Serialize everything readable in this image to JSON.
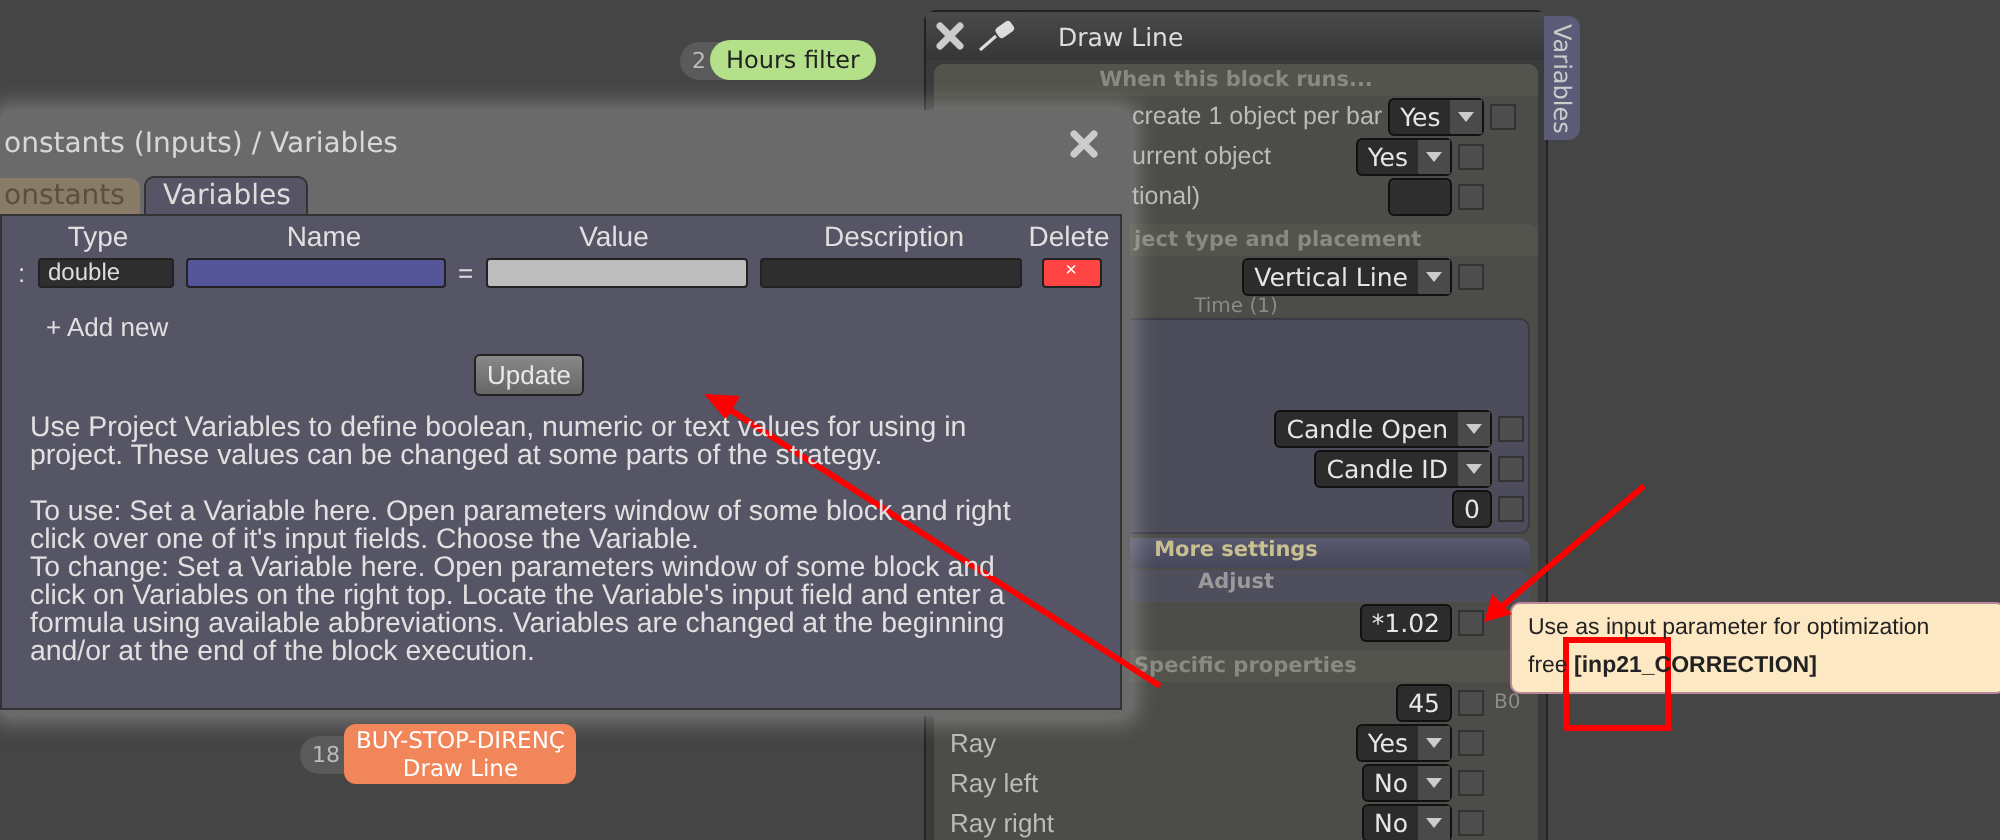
{
  "canvas_nodes": [
    {
      "number": "2",
      "label": "Hours filter",
      "color": "#b5e08a"
    },
    {
      "number": "18",
      "label": "BUY-STOP-DIRENÇ",
      "sublabel": "Draw Line",
      "color": "#f0865a"
    }
  ],
  "block_panel": {
    "title": "Draw Line",
    "side_tab": "Variables",
    "rows": [
      {
        "kind": "header",
        "text": "When this block runs..."
      },
      {
        "kind": "dropdown",
        "label": "create 1 object per bar",
        "value": "Yes",
        "checked": false
      },
      {
        "kind": "dropdown",
        "label": "urrent object",
        "value": "Yes",
        "checked": false
      },
      {
        "kind": "field",
        "label": "tional)",
        "checked": false
      },
      {
        "kind": "header",
        "text": "ject type and placement"
      },
      {
        "kind": "dropdown",
        "value": "Vertical Line",
        "checked": false
      },
      {
        "kind": "inset",
        "title": "Time (1)",
        "rows": [
          {
            "kind": "dropdown",
            "value": "Candle Open",
            "checked": false
          },
          {
            "kind": "dropdown",
            "value": "Candle ID",
            "checked": false
          },
          {
            "kind": "value",
            "value": "0",
            "checked": false
          }
        ]
      },
      {
        "kind": "band",
        "text": "More settings"
      },
      {
        "kind": "subheader",
        "text": "Adjust"
      },
      {
        "kind": "value",
        "value": "*1.02",
        "checked": false
      },
      {
        "kind": "header",
        "text": "Specific properties"
      },
      {
        "kind": "value",
        "value": "45",
        "checked": false,
        "note": "B0"
      },
      {
        "kind": "dropdown",
        "label": "Ray",
        "value": "Yes",
        "checked": false
      },
      {
        "kind": "dropdown",
        "label": "Ray left",
        "value": "No",
        "checked": false
      },
      {
        "kind": "dropdown",
        "label": "Ray right",
        "value": "No",
        "checked": false
      }
    ]
  },
  "tooltip": {
    "line_1": "Use as input parameter for optimization",
    "line_2": "free **[inp21_CORRECTION]**"
  },
  "dialog": {
    "title": "onstants (Inputs) / Variables",
    "tabs": [
      {
        "label": "onstants",
        "selected": false
      },
      {
        "label": "Variables",
        "selected": true
      }
    ],
    "columns": [
      "Type",
      "Name",
      "Value",
      "Description",
      "Delete"
    ],
    "row": {
      "mark": ":",
      "type": "double",
      "equals": "=",
      "delete": "×"
    },
    "add_new": "+ Add new",
    "update": "Update",
    "paragraphs": [
      "Use Project Variables to define boolean, numeric or text values for using in project. These values can be changed at some parts of the strategy.",
      "To use: Set a Variable here. Open parameters window of some block and right click over one of it's input fields. Choose the Variable.",
      "To change: Set a Variable here. Open parameters window of some block and click on Variables on the right top. Locate the Variable's input field and enter a formula using available abbreviations. Variables are changed at the beginning and/or at the end of the block execution."
    ]
  }
}
